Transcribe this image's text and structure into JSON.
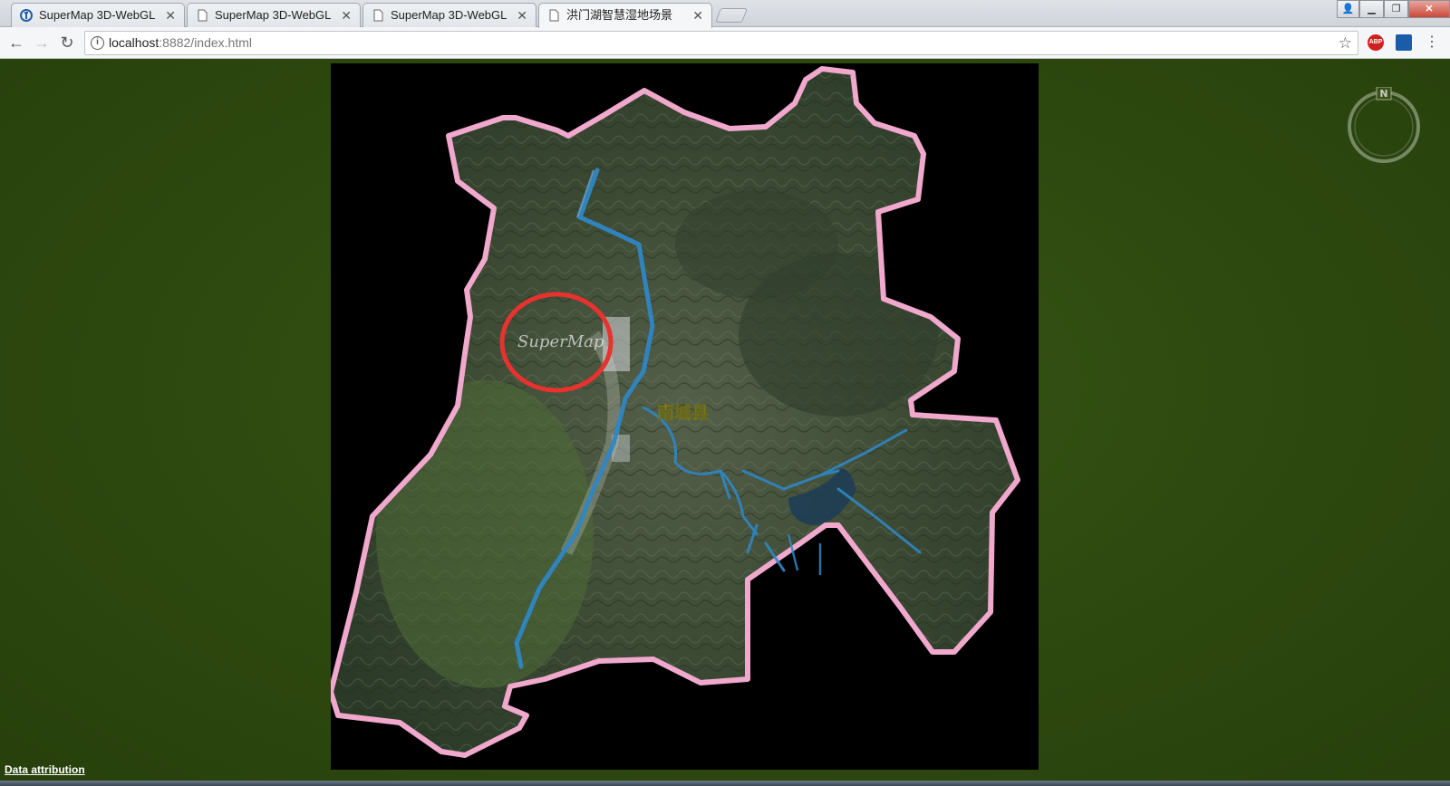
{
  "browser": {
    "tabs": [
      {
        "title": "SuperMap 3D-WebGL",
        "icon": "supermap-favicon"
      },
      {
        "title": "SuperMap 3D-WebGL",
        "icon": "page-icon"
      },
      {
        "title": "SuperMap 3D-WebGL",
        "icon": "page-icon"
      },
      {
        "title": "洪门湖智慧湿地场景",
        "icon": "page-icon",
        "active": true
      }
    ],
    "url_host": "localhost",
    "url_rest": ":8882/index.html",
    "extensions": {
      "abp_label": "ABP"
    }
  },
  "scene": {
    "county_label": "南城县",
    "watermark": "SuperMap",
    "compass_label": "N",
    "attribution": "Data attribution",
    "colors": {
      "boundary": "#f0a8cc",
      "river": "#2f86c4",
      "highlight_circle": "#e8322e",
      "label": "#f2e640",
      "terrain": "#3d4a33",
      "background": "#2a4410"
    }
  }
}
